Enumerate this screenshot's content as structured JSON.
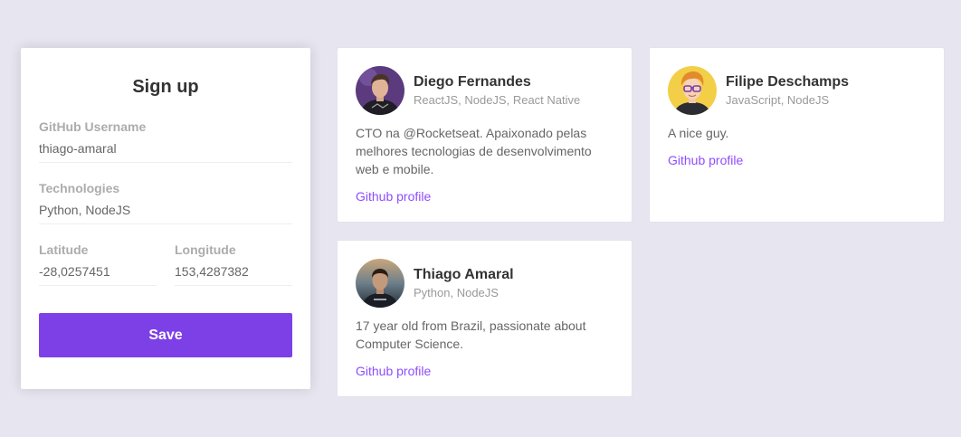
{
  "form": {
    "title": "Sign up",
    "github_label": "GitHub Username",
    "github_value": "thiago-amaral",
    "techs_label": "Technologies",
    "techs_value": "Python, NodeJS",
    "latitude_label": "Latitude",
    "latitude_value": "-28,0257451",
    "longitude_label": "Longitude",
    "longitude_value": "153,4287382",
    "save_label": "Save"
  },
  "devs": [
    {
      "name": "Diego Fernandes",
      "techs": "ReactJS, NodeJS, React Native",
      "bio": "CTO na @Rocketseat. Apaixonado pelas melhores tecnologias de desenvolvimento web e mobile.",
      "link_label": "Github profile",
      "avatar_icon": "person-photo-icon"
    },
    {
      "name": "Filipe Deschamps",
      "techs": "JavaScript, NodeJS",
      "bio": "A nice guy.",
      "link_label": "Github profile",
      "avatar_icon": "cartoon-avatar-icon"
    },
    {
      "name": "Thiago Amaral",
      "techs": "Python, NodeJS",
      "bio": "17 year old from Brazil, passionate about Computer Science.",
      "link_label": "Github profile",
      "avatar_icon": "person-photo-icon"
    }
  ],
  "colors": {
    "background": "#e7e6f0",
    "accent": "#7d40e7",
    "link": "#8e4dff"
  }
}
